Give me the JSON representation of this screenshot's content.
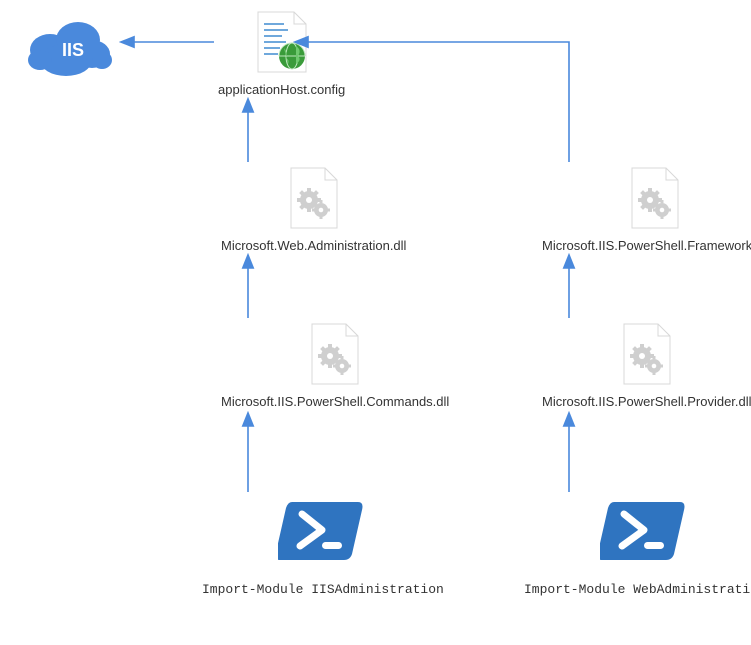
{
  "cloud": {
    "label": "IIS"
  },
  "config": {
    "label": "applicationHost.config"
  },
  "leftDll1": {
    "label": "Microsoft.Web.Administration.dll"
  },
  "leftDll2": {
    "label": "Microsoft.IIS.PowerShell.Commands.dll"
  },
  "rightDll1": {
    "label": "Microsoft.IIS.PowerShell.Framework.dll"
  },
  "rightDll2": {
    "label": "Microsoft.IIS.PowerShell.Provider.dll"
  },
  "leftCmd": {
    "label": "Import-Module IISAdministration"
  },
  "rightCmd": {
    "label": "Import-Module WebAdministration"
  },
  "colors": {
    "arrow": "#4a89dc",
    "psBlue": "#2f74c0",
    "cloud": "#3a7bd5",
    "gear": "#c0c0c0",
    "page": "#f5f5f5",
    "pageBorder": "#d0d0d0"
  }
}
